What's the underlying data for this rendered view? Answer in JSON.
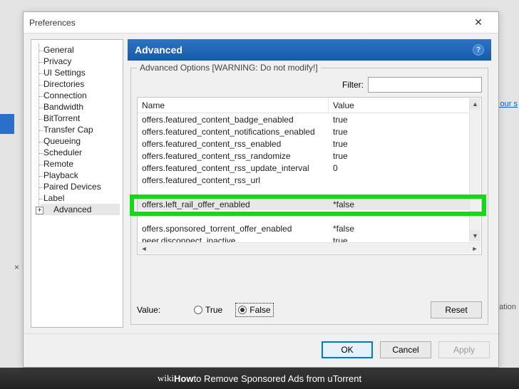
{
  "window": {
    "title": "Preferences",
    "close_glyph": "✕"
  },
  "tree": {
    "items": [
      "General",
      "Privacy",
      "UI Settings",
      "Directories",
      "Connection",
      "Bandwidth",
      "BitTorrent",
      "Transfer Cap",
      "Queueing",
      "Scheduler",
      "Remote",
      "Playback",
      "Paired Devices",
      "Label",
      "Advanced"
    ],
    "selected_index": 14,
    "expander_glyph": "+"
  },
  "panel": {
    "heading": "Advanced",
    "help_glyph": "?",
    "group_label": "Advanced Options [WARNING: Do not modify!]",
    "filter_label": "Filter:",
    "filter_value": ""
  },
  "columns": {
    "name": "Name",
    "value": "Value"
  },
  "rows": [
    {
      "name": "offers.featured_content_badge_enabled",
      "value": "true"
    },
    {
      "name": "offers.featured_content_notifications_enabled",
      "value": "true"
    },
    {
      "name": "offers.featured_content_rss_enabled",
      "value": "true"
    },
    {
      "name": "offers.featured_content_rss_randomize",
      "value": "true"
    },
    {
      "name": "offers.featured_content_rss_update_interval",
      "value": "0"
    },
    {
      "name": "offers.featured_content_rss_url",
      "value": ""
    },
    {
      "name": "",
      "value": ""
    },
    {
      "name": "offers.left_rail_offer_enabled",
      "value": "*false"
    },
    {
      "name": "",
      "value": ""
    },
    {
      "name": "offers.sponsored_torrent_offer_enabled",
      "value": "*false"
    },
    {
      "name": "peer.disconnect_inactive",
      "value": "true"
    }
  ],
  "selected_row_index": 7,
  "value_editor": {
    "label": "Value:",
    "true_label": "True",
    "false_label": "False",
    "selected": "false",
    "reset_label": "Reset"
  },
  "dialog_buttons": {
    "ok": "OK",
    "cancel": "Cancel",
    "apply": "Apply"
  },
  "background": {
    "link_text": "te our s",
    "right_text": "uration",
    "close_x": "×"
  },
  "caption": {
    "prefix": "wiki",
    "mid": "How",
    "rest": " to Remove Sponsored Ads from uTorrent"
  }
}
